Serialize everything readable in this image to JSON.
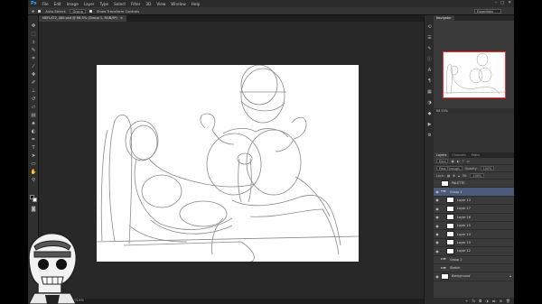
{
  "menubar": {
    "app_logo": "Ps",
    "items": [
      "File",
      "Edit",
      "Image",
      "Layer",
      "Type",
      "Select",
      "Filter",
      "3D",
      "View",
      "Window",
      "Help"
    ],
    "window_controls": [
      "–",
      "□",
      "✕"
    ]
  },
  "options_bar": {
    "auto_select_label": "Auto-Select:",
    "auto_select_value": "Group",
    "show_transform_label": "Show Transform Controls",
    "workspace": "Essentials"
  },
  "document": {
    "tab_title": "NEFLAT2_480.psd @ 66.5% (Group 1, RGB/8*)",
    "status_zoom": "66.53%",
    "status_doc": "Doc: 4.63M/93.9M"
  },
  "tools": {
    "icons": [
      "move-tool-icon",
      "marquee-tool-icon",
      "lasso-tool-icon",
      "quick-select-icon",
      "crop-tool-icon",
      "eyedropper-icon",
      "healing-brush-icon",
      "brush-tool-icon",
      "clone-stamp-icon",
      "history-brush-icon",
      "eraser-icon",
      "gradient-tool-icon",
      "blur-tool-icon",
      "dodge-tool-icon",
      "pen-tool-icon",
      "type-tool-icon",
      "path-select-icon",
      "shape-tool-icon",
      "hand-tool-icon",
      "zoom-tool-icon"
    ]
  },
  "navigator": {
    "tabs": [
      "Navigator"
    ],
    "zoom": "66.53%"
  },
  "layers_panel": {
    "tabs": [
      "Layers",
      "Channels",
      "Paths"
    ],
    "kind_filter": "Kind",
    "blend_mode": "Pass Through",
    "opacity_label": "Opacity:",
    "opacity_value": "100%",
    "lock_label": "Lock:",
    "fill_label": "Fill:",
    "fill_value": "100%",
    "layers": [
      {
        "name": "PALETTE",
        "type": "layer",
        "visible": false,
        "selected": false
      },
      {
        "name": "Group 1",
        "type": "group",
        "visible": true,
        "selected": true
      },
      {
        "name": "Layer 13",
        "type": "layer",
        "visible": true,
        "selected": false
      },
      {
        "name": "Layer 17",
        "type": "layer",
        "visible": true,
        "selected": false
      },
      {
        "name": "Layer 16",
        "type": "layer",
        "visible": true,
        "selected": false
      },
      {
        "name": "Layer 15",
        "type": "layer",
        "visible": true,
        "selected": false
      },
      {
        "name": "Layer 14",
        "type": "layer",
        "visible": true,
        "selected": false
      },
      {
        "name": "Layer 10",
        "type": "layer",
        "visible": true,
        "selected": false
      },
      {
        "name": "Layer 12",
        "type": "layer",
        "visible": true,
        "selected": false
      },
      {
        "name": "Group 2",
        "type": "group",
        "visible": false,
        "selected": false
      },
      {
        "name": "Sketch",
        "type": "group",
        "visible": false,
        "selected": false
      },
      {
        "name": "Background",
        "type": "layer",
        "visible": true,
        "selected": false,
        "locked": true
      }
    ],
    "footer_icons": [
      "link-icon",
      "fx-icon",
      "mask-icon",
      "adjustment-icon",
      "new-group-icon",
      "new-layer-icon",
      "trash-icon"
    ]
  },
  "colors": {
    "ui_dark": "#1e1e1e",
    "panel": "#3a3a3a",
    "accent_blue": "#31a8ff",
    "selection": "#4a5a78",
    "nav_box": "#ff3030"
  }
}
